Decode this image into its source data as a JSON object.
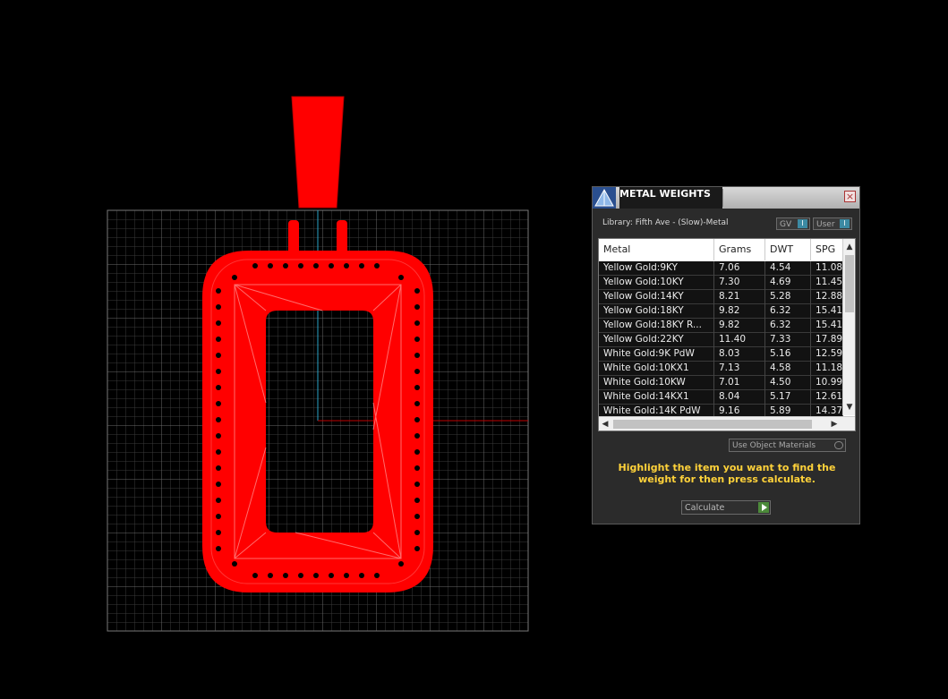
{
  "panel": {
    "title": "METAL WEIGHTS",
    "close_glyph": "×",
    "library_label": "Library: Fifth Ave - (Slow)-Metal",
    "toggle_gv": "GV",
    "toggle_user": "User",
    "use_object_materials": "Use Object Materials",
    "hint": "Highlight the item you want to find the weight for then press calculate.",
    "calculate_label": "Calculate"
  },
  "table": {
    "columns": [
      "Metal",
      "Grams",
      "DWT",
      "SPG"
    ],
    "rows": [
      [
        "Yellow Gold:9KY",
        "7.06",
        "4.54",
        "11.08"
      ],
      [
        "Yellow Gold:10KY",
        "7.30",
        "4.69",
        "11.45"
      ],
      [
        "Yellow Gold:14KY",
        "8.21",
        "5.28",
        "12.88"
      ],
      [
        "Yellow Gold:18KY",
        "9.82",
        "6.32",
        "15.41"
      ],
      [
        "Yellow Gold:18KY R...",
        "9.82",
        "6.32",
        "15.41"
      ],
      [
        "Yellow Gold:22KY",
        "11.40",
        "7.33",
        "17.89"
      ],
      [
        "White Gold:9K PdW",
        "8.03",
        "5.16",
        "12.59"
      ],
      [
        "White Gold:10KX1",
        "7.13",
        "4.58",
        "11.18"
      ],
      [
        "White Gold:10KW",
        "7.01",
        "4.50",
        "10.99"
      ],
      [
        "White Gold:14KX1",
        "8.04",
        "5.17",
        "12.61"
      ],
      [
        "White Gold:14K PdW",
        "9.16",
        "5.89",
        "14.37"
      ]
    ]
  },
  "icons": {
    "logo": "pyramid-logo-icon",
    "close": "close-icon",
    "scroll_up": "chevron-up-icon",
    "scroll_down": "chevron-down-icon",
    "scroll_left": "chevron-left-icon",
    "scroll_right": "chevron-right-icon",
    "calculate": "play-icon"
  },
  "colors": {
    "model": "#ff0000",
    "grid": "#606060",
    "hint": "#ffd23a",
    "axis_x": "#c00000",
    "axis_y": "#2aa3c8"
  }
}
